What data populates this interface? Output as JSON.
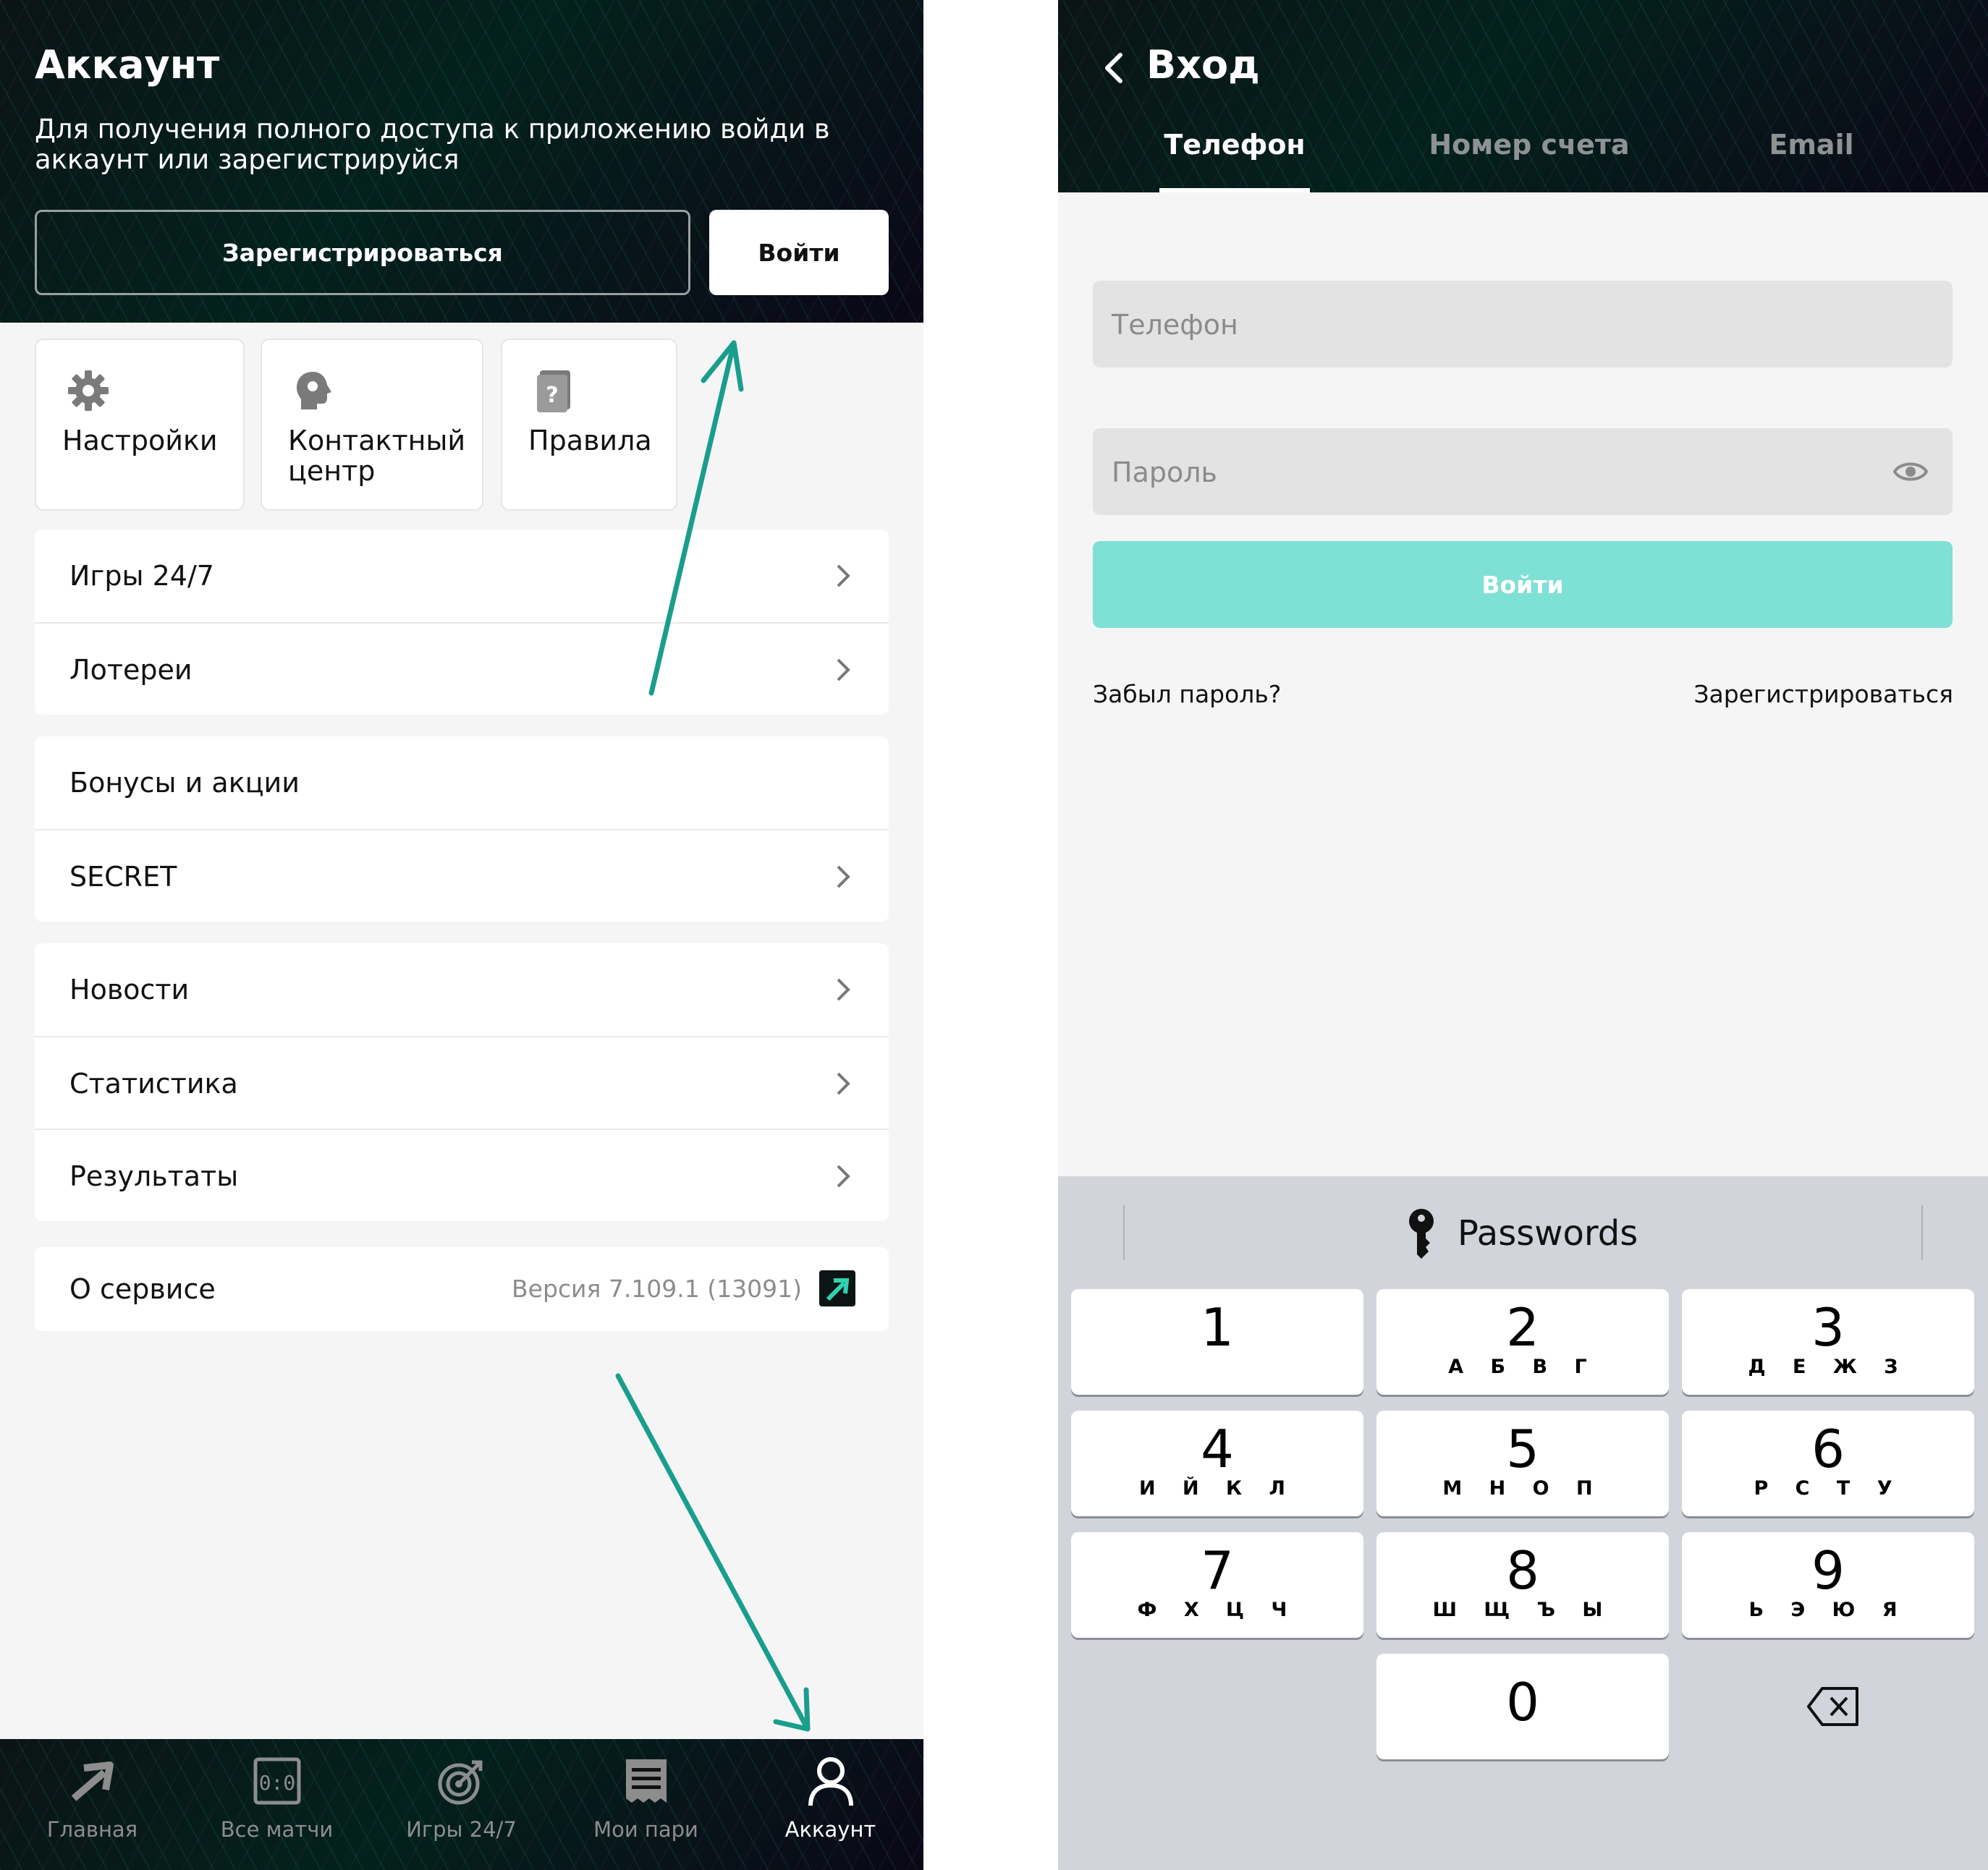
{
  "left": {
    "title": "Аккаунт",
    "subtitle": "Для получения полного доступа к приложению войди в аккаунт или зарегистрируйся",
    "register_button": "Зарегистрироваться",
    "login_button": "Войти",
    "tiles": [
      {
        "label": "Настройки",
        "icon": "gear-icon"
      },
      {
        "label": "Контактный центр",
        "icon": "support-head-icon"
      },
      {
        "label": "Правила",
        "icon": "rules-book-icon"
      }
    ],
    "groups": [
      {
        "items": [
          {
            "label": "Игры 24/7",
            "chevron": true
          },
          {
            "label": "Лотереи",
            "chevron": true
          }
        ]
      },
      {
        "items": [
          {
            "label": "Бонусы и акции",
            "chevron": false
          },
          {
            "label": "SECRET",
            "chevron": true
          }
        ]
      },
      {
        "items": [
          {
            "label": "Новости",
            "chevron": true
          },
          {
            "label": "Статистика",
            "chevron": true
          },
          {
            "label": "Результаты",
            "chevron": true
          }
        ]
      },
      {
        "items": [
          {
            "label": "О сервисе",
            "version": "Версия 7.109.1 (13091)"
          }
        ]
      }
    ],
    "tabbar": [
      {
        "label": "Главная",
        "icon": "home-arrow-icon",
        "active": false
      },
      {
        "label": "Все матчи",
        "icon": "scoreboard-icon",
        "active": false
      },
      {
        "label": "Игры 24/7",
        "icon": "target-icon",
        "active": false
      },
      {
        "label": "Мои пари",
        "icon": "receipt-icon",
        "active": false
      },
      {
        "label": "Аккаунт",
        "icon": "person-icon",
        "active": true
      }
    ],
    "accent_arrow_color": "#1a9e8c"
  },
  "right": {
    "title": "Вход",
    "tabs": [
      {
        "label": "Телефон",
        "active": true
      },
      {
        "label": "Номер счета",
        "active": false
      },
      {
        "label": "Email",
        "active": false
      }
    ],
    "phone_placeholder": "Телефон",
    "password_placeholder": "Пароль",
    "submit_button": "Войти",
    "forgot_link": "Забыл пароль?",
    "register_link": "Зарегистрироваться",
    "button_color": "#7fe0d6",
    "keyboard": {
      "passwords_label": "Passwords",
      "keys": [
        {
          "digit": "1",
          "letters": ""
        },
        {
          "digit": "2",
          "letters": "А Б В Г"
        },
        {
          "digit": "3",
          "letters": "Д Е Ж З"
        },
        {
          "digit": "4",
          "letters": "И Й К Л"
        },
        {
          "digit": "5",
          "letters": "М Н О П"
        },
        {
          "digit": "6",
          "letters": "Р С Т У"
        },
        {
          "digit": "7",
          "letters": "Ф Х Ц Ч"
        },
        {
          "digit": "8",
          "letters": "Ш Щ Ъ Ы"
        },
        {
          "digit": "9",
          "letters": "Ь Э Ю Я"
        },
        {
          "digit": "0",
          "letters": ""
        }
      ]
    }
  }
}
